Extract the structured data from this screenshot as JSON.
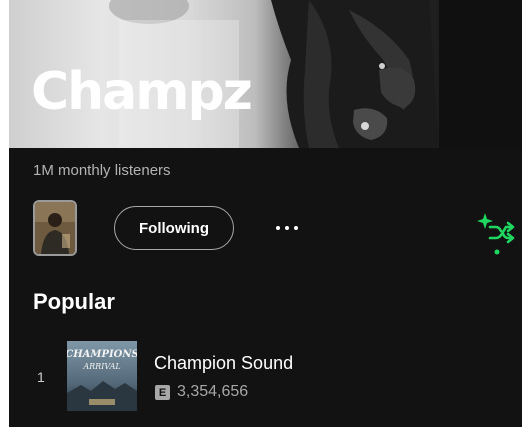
{
  "artist": {
    "name": "Champz",
    "monthly_listeners": "1M monthly listeners"
  },
  "actions": {
    "follow_label": "Following",
    "more_icon": "more-options-icon",
    "shuffle_icon": "smart-shuffle-icon"
  },
  "popular": {
    "title": "Popular",
    "tracks": [
      {
        "index": "1",
        "title": "Champion Sound",
        "explicit_badge": "E",
        "plays": "3,354,656",
        "cover_text_line1": "CHAMPIONS",
        "cover_text_line2": "ARRIVAL"
      }
    ]
  },
  "colors": {
    "background": "#121212",
    "accent_green": "#1ed760",
    "secondary_text": "#b3b3b3"
  }
}
